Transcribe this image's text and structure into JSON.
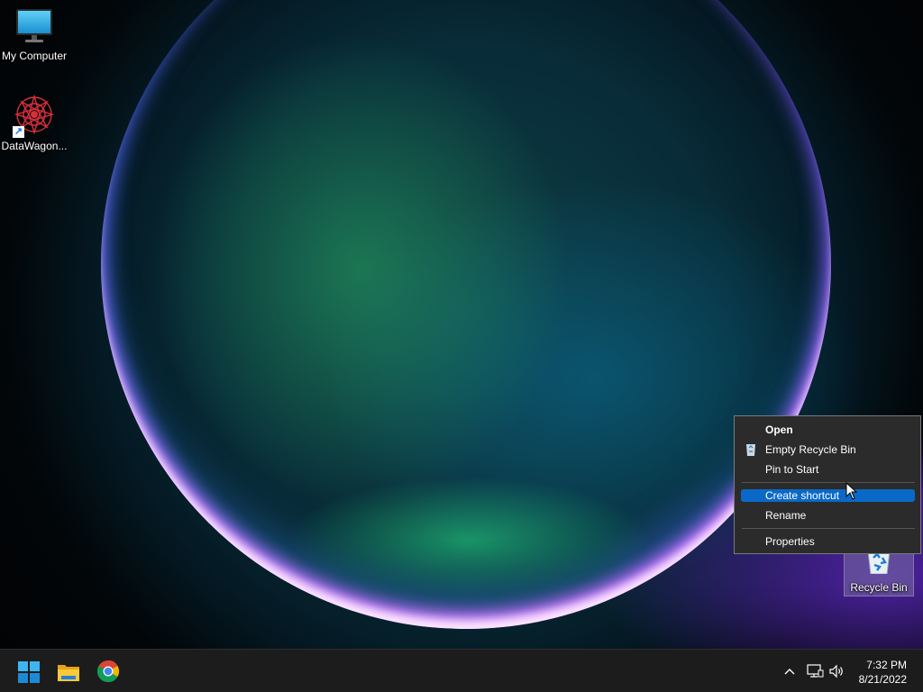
{
  "desktop": {
    "icons": [
      {
        "label": "My Computer",
        "icon": "monitor-icon"
      },
      {
        "label": "DataWagon...",
        "icon": "datawagon-app-icon"
      },
      {
        "label": "Recycle Bin",
        "icon": "recycle-bin-icon"
      }
    ]
  },
  "context_menu": {
    "items": [
      {
        "label": "Open",
        "bold": true
      },
      {
        "label": "Empty Recycle Bin",
        "icon": "recycle-bin-small-icon"
      },
      {
        "label": "Pin to Start"
      },
      {
        "label": "Create shortcut",
        "highlighted": true
      },
      {
        "label": "Rename"
      },
      {
        "label": "Properties"
      }
    ],
    "highlight_color": "#0a69c7"
  },
  "taskbar": {
    "pinned": [
      {
        "name": "Start",
        "icon": "windows-start-icon"
      },
      {
        "name": "File Explorer",
        "icon": "folder-icon"
      },
      {
        "name": "Google Chrome",
        "icon": "chrome-icon"
      }
    ],
    "tray": {
      "icons": [
        "chevron-up-icon",
        "network-icon",
        "volume-icon"
      ],
      "time": "7:32 PM",
      "date": "8/21/2022"
    }
  },
  "colors": {
    "taskbar_bg": "#1c1c1c",
    "menu_bg": "#2b2b2b",
    "accent": "#0a69c7"
  }
}
